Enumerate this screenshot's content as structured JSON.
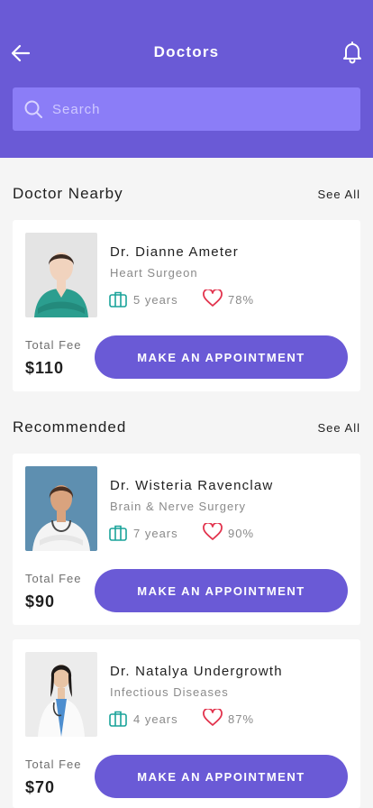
{
  "header": {
    "title": "Doctors",
    "back_icon": "arrow-left-icon",
    "bell_icon": "bell-icon",
    "accent_color": "#6a5ad6"
  },
  "search": {
    "placeholder": "Search",
    "icon": "search-icon"
  },
  "sections": {
    "nearby": {
      "title": "Doctor Nearby",
      "see_all": "See All"
    },
    "recommended": {
      "title": "Recommended",
      "see_all": "See All"
    }
  },
  "doctors": [
    {
      "name": "Dr. Dianne Ameter",
      "specialty": "Heart Surgeon",
      "experience": "5 years",
      "rating": "78%",
      "fee_label": "Total Fee",
      "fee": "$110",
      "button": "MAKE AN APPOINTMENT"
    },
    {
      "name": "Dr. Wisteria Ravenclaw",
      "specialty": "Brain & Nerve Surgery",
      "experience": "7 years",
      "rating": "90%",
      "fee_label": "Total Fee",
      "fee": "$90",
      "button": "MAKE AN APPOINTMENT"
    },
    {
      "name": "Dr. Natalya Undergrowth",
      "specialty": "Infectious Diseases",
      "experience": "4 years",
      "rating": "87%",
      "fee_label": "Total Fee",
      "fee": "$70",
      "button": "MAKE AN APPOINTMENT"
    }
  ],
  "icons": {
    "experience": "briefcase-icon",
    "rating": "heart-icon"
  },
  "colors": {
    "experience_icon": "#1aa39a",
    "heart_icon": "#e2334d"
  }
}
